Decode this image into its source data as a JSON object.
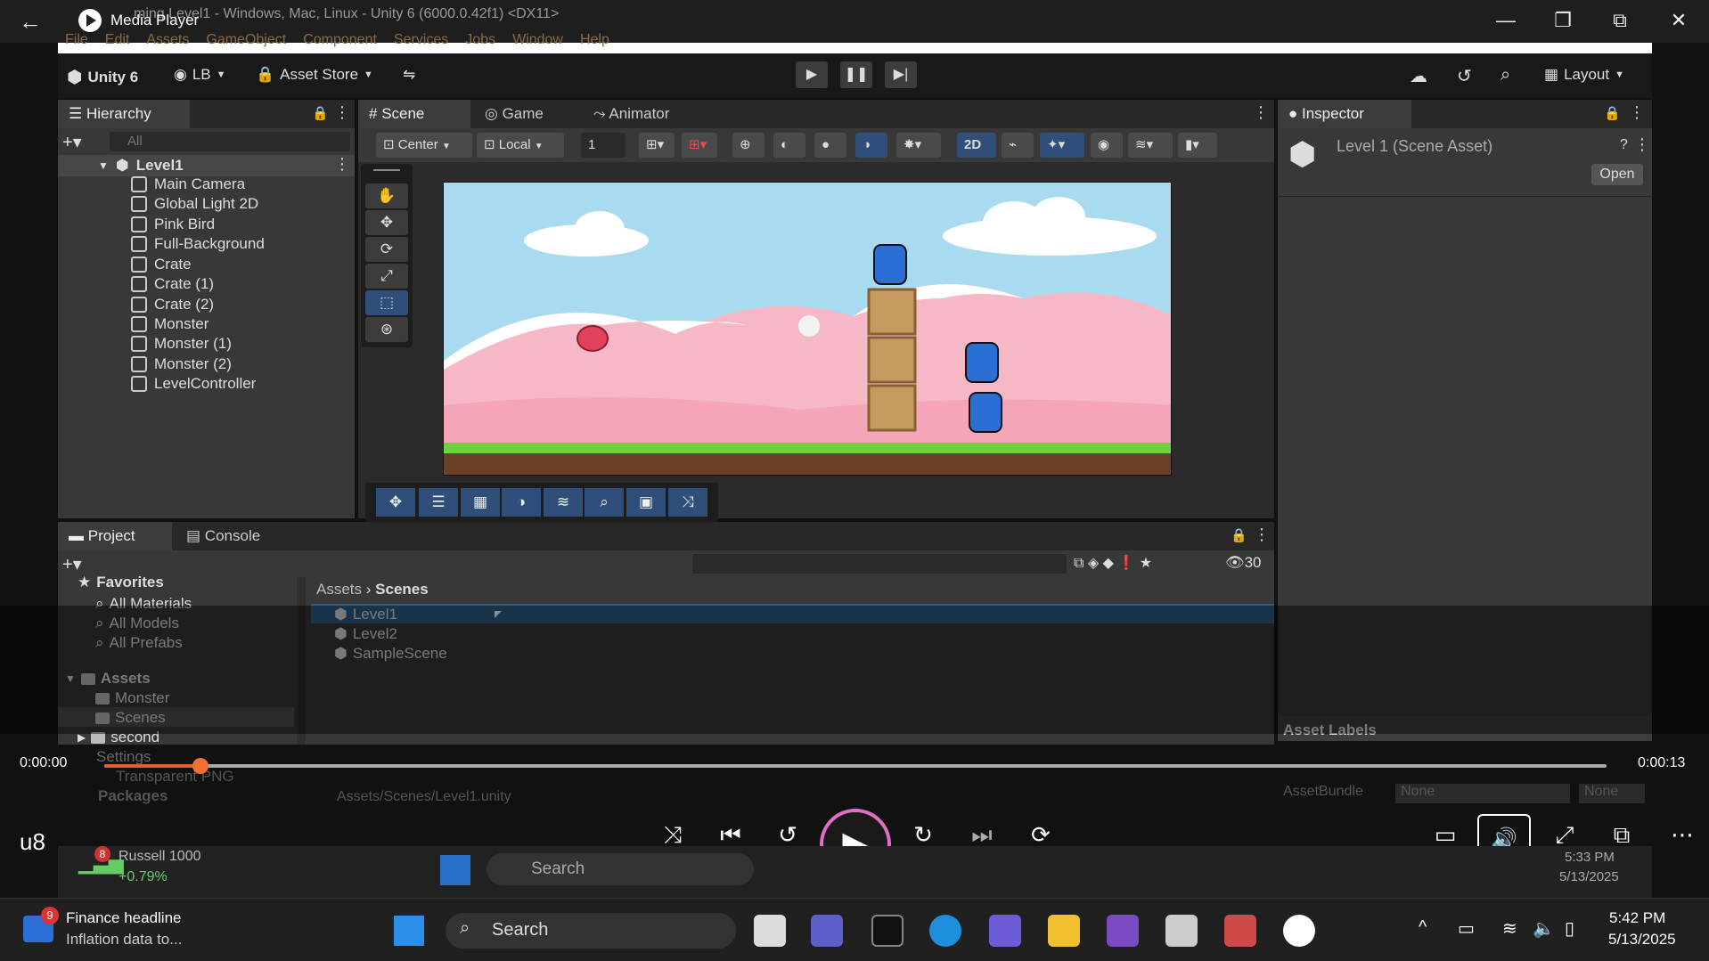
{
  "media_player": {
    "app_name": "Media Player",
    "window_title": "Level1 - Windows, Mac, Linux - Unity 6 (6000.0.42f1) <DX11>",
    "window_title_prefix": "ming",
    "time_current": "0:00:00",
    "time_total": "0:00:13",
    "left_label": "u8",
    "progress": 0.065
  },
  "unity": {
    "menu": [
      "File",
      "Edit",
      "Assets",
      "GameObject",
      "Component",
      "Services",
      "Jobs",
      "Window",
      "Help"
    ],
    "toolbar": {
      "unity_label": "Unity 6",
      "account": "LB",
      "asset_store": "Asset Store",
      "layout": "Layout"
    },
    "hierarchy": {
      "tab": "Hierarchy",
      "search_placeholder": "All",
      "scene": "Level1",
      "items": [
        "Main Camera",
        "Global Light 2D",
        "Pink Bird",
        "Full-Background",
        "Crate",
        "Crate (1)",
        "Crate (2)",
        "Monster",
        "Monster (1)",
        "Monster (2)",
        "LevelController"
      ]
    },
    "scene_tabs": [
      "Scene",
      "Game",
      "Animator"
    ],
    "scene_toolbar": {
      "pivot": "Center",
      "space": "Local",
      "snap": "1",
      "mode_2d": "2D"
    },
    "inspector": {
      "tab": "Inspector",
      "asset_title": "Level 1 (Scene Asset)",
      "open_button": "Open",
      "asset_labels": "Asset Labels",
      "assetbundle_label": "AssetBundle",
      "assetbundle_value": "None",
      "assetbundle_variant": "None"
    },
    "project": {
      "tabs": [
        "Project",
        "Console"
      ],
      "hidden_count": "30",
      "favorites_label": "Favorites",
      "favorites": [
        "All Materials",
        "All Models",
        "All Prefabs"
      ],
      "assets_label": "Assets",
      "folders": [
        "Monster",
        "Scenes",
        "second",
        "Settings",
        "Transparent PNG"
      ],
      "packages_label": "Packages",
      "breadcrumb": [
        "Assets",
        "Scenes"
      ],
      "files": [
        "Level1",
        "Level2",
        "SampleScene"
      ],
      "status_path": "Assets/Scenes/Level1.unity"
    },
    "inner_taskbar": {
      "stock_name": "Russell 1000",
      "stock_change": "+0.79%",
      "stock_badge": "8",
      "search": "Search",
      "time": "5:33 PM",
      "date": "5/13/2025"
    }
  },
  "taskbar": {
    "news_badge": "9",
    "news_title": "Finance headline",
    "news_sub": "Inflation data to...",
    "search": "Search",
    "time": "5:42 PM",
    "date": "5/13/2025"
  },
  "colors": {
    "selection": "#2c5d87",
    "accent": "#e15f2e",
    "sky": "#9ed7ee",
    "grass": "#6fcf3f"
  }
}
